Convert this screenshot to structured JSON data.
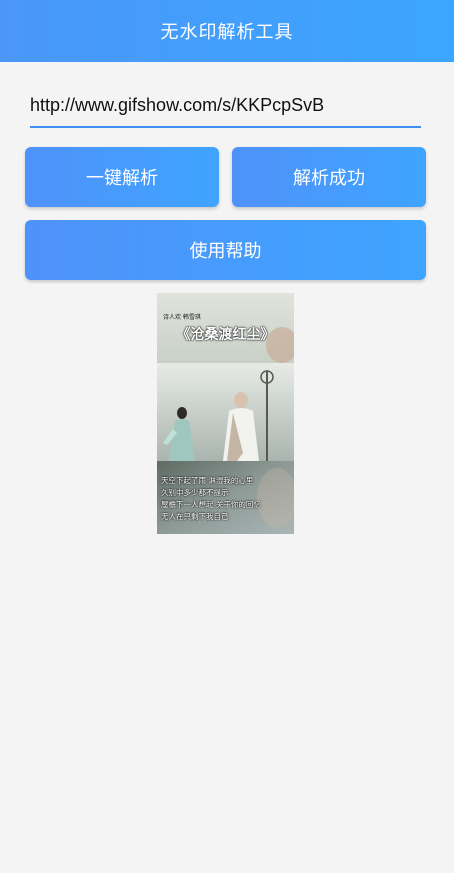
{
  "header": {
    "title": "无水印解析工具"
  },
  "url_input": {
    "value": "http://www.gifshow.com/s/KKPcpSvB"
  },
  "buttons": {
    "parse": "一键解析",
    "status": "解析成功",
    "help": "使用帮助"
  },
  "preview": {
    "credit": "诗人欢 韩雪琪",
    "title": "《沧桑渡红尘》",
    "lyrics": [
      "天空下起了雨 淋湿我的心里",
      "久别中多少都不提示",
      "屋檐下一人想起 关于你的回忆",
      "无人在只剩下我自己"
    ]
  },
  "colors": {
    "header_gradient": [
      "#4a97f7",
      "#3ba6ff"
    ],
    "button_gradient": [
      "#4f92f9",
      "#3fa4ff"
    ],
    "underline": "#3f8ef2",
    "background": "#f4f4f4"
  }
}
